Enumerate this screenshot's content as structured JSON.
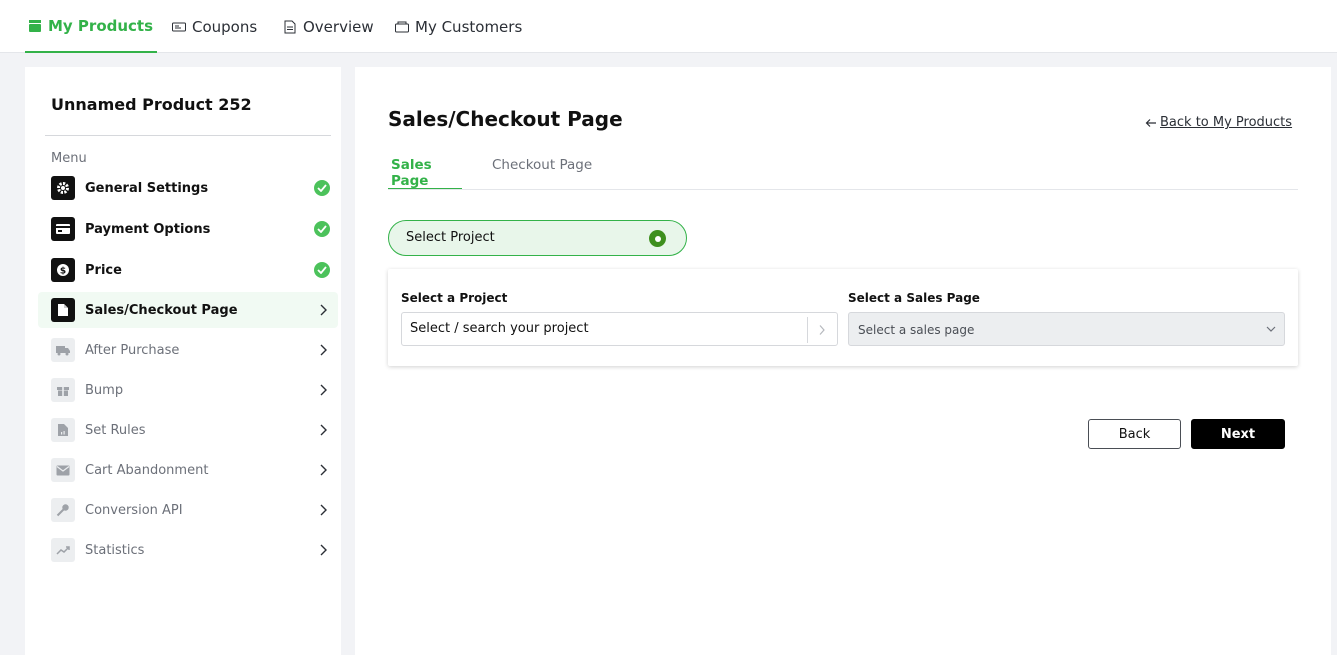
{
  "topnav": {
    "tabs": [
      {
        "label": "My Products",
        "icon": "store-icon",
        "active": true
      },
      {
        "label": "Coupons",
        "icon": "ticket-icon",
        "active": false
      },
      {
        "label": "Overview",
        "icon": "document-icon",
        "active": false
      },
      {
        "label": "My Customers",
        "icon": "folder-icon",
        "active": false
      }
    ]
  },
  "sidebar": {
    "product_title": "Unnamed Product 252",
    "menu_label": "Menu",
    "items": [
      {
        "label": "General Settings",
        "icon": "gear-icon",
        "status": "complete"
      },
      {
        "label": "Payment Options",
        "icon": "credit-card-icon",
        "status": "complete"
      },
      {
        "label": "Price",
        "icon": "dollar-icon",
        "status": "complete"
      },
      {
        "label": "Sales/Checkout Page",
        "icon": "page-icon",
        "status": "current"
      },
      {
        "label": "After Purchase",
        "icon": "truck-icon",
        "status": "locked"
      },
      {
        "label": "Bump",
        "icon": "gift-icon",
        "status": "locked"
      },
      {
        "label": "Set Rules",
        "icon": "rules-icon",
        "status": "locked"
      },
      {
        "label": "Cart Abandonment",
        "icon": "mail-icon",
        "status": "locked"
      },
      {
        "label": "Conversion API",
        "icon": "key-icon",
        "status": "locked"
      },
      {
        "label": "Statistics",
        "icon": "trend-icon",
        "status": "locked"
      }
    ]
  },
  "main": {
    "title": "Sales/Checkout Page",
    "back_link": "Back to My Products",
    "tabs": [
      {
        "label": "Sales Page",
        "active": true
      },
      {
        "label": "Checkout Page",
        "active": false
      }
    ],
    "step": {
      "label": "Select Project"
    },
    "project_field": {
      "label": "Select a Project",
      "placeholder": "Select / search your project"
    },
    "sales_page_field": {
      "label": "Select a Sales Page",
      "placeholder": "Select a sales page"
    },
    "buttons": {
      "back": "Back",
      "next": "Next"
    }
  },
  "colors": {
    "accent": "#33b249",
    "check": "#4cc25b",
    "step_dot": "#3e8f1e",
    "page_bg": "#f2f3f6"
  }
}
